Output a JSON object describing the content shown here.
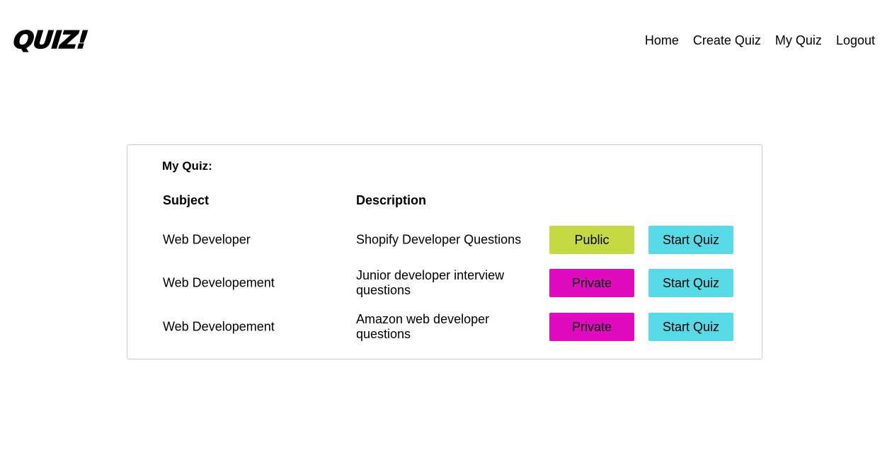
{
  "header": {
    "logo": "QUIZ!",
    "nav": [
      "Home",
      "Create Quiz",
      "My Quiz",
      "Logout"
    ]
  },
  "card": {
    "title": "My Quiz:",
    "headers": {
      "subject": "Subject",
      "description": "Description"
    },
    "rows": [
      {
        "subject": "Web Developer",
        "description": "Shopify Developer Questions",
        "visibility": "Public",
        "action": "Start Quiz"
      },
      {
        "subject": "Web Developement",
        "description": "Junior developer interview questions",
        "visibility": "Private",
        "action": "Start Quiz"
      },
      {
        "subject": "Web Developement",
        "description": "Amazon web developer questions",
        "visibility": "Private",
        "action": "Start Quiz"
      }
    ]
  },
  "colors": {
    "public": "#c4d944",
    "private": "#de0cbe",
    "start": "#57dae6"
  }
}
